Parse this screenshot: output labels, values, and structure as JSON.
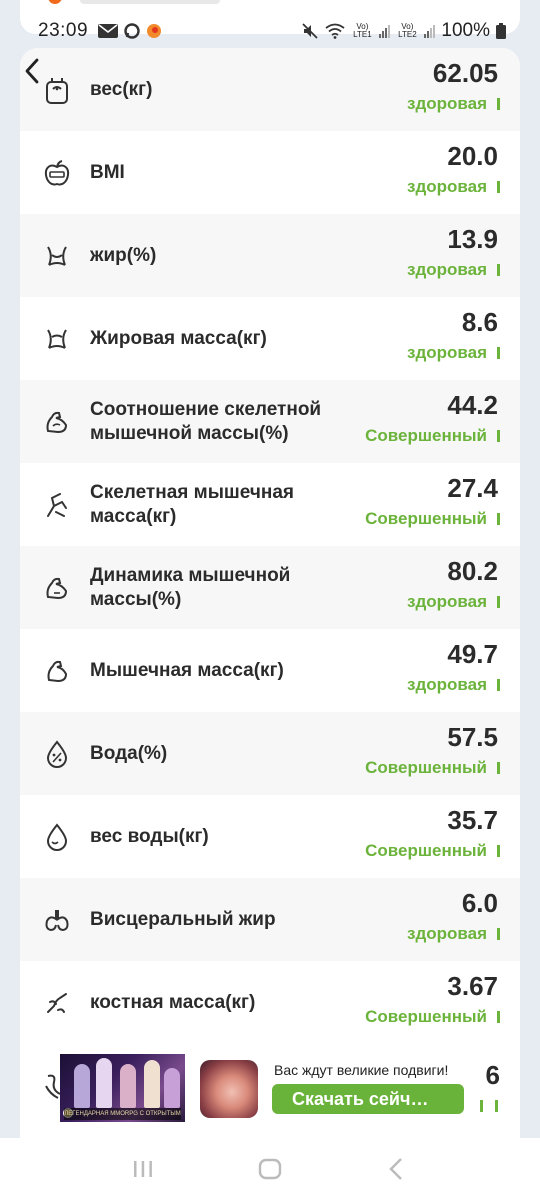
{
  "status_bar": {
    "time": "23:09",
    "battery_text": "100%",
    "sim1_label": "Vo) LTE1",
    "sim2_label": "Vo) LTE2",
    "icons": [
      "mail-icon",
      "messenger-icon",
      "app-notification-icon",
      "mute-icon",
      "wifi-icon",
      "signal-icon",
      "battery-icon"
    ]
  },
  "colors": {
    "accent_green": "#6bb33b",
    "text_dark": "#2b2b2b",
    "row_alt_bg": "#f7f7f7"
  },
  "metrics": [
    {
      "label": "вес(кг)",
      "value": "62.05",
      "status": "здоровая",
      "icon": "scale-icon"
    },
    {
      "label": "BMI",
      "value": "20.0",
      "status": "здоровая",
      "icon": "bmi-apple-icon"
    },
    {
      "label": "жир(%)",
      "value": "13.9",
      "status": "здоровая",
      "icon": "body-fat-icon"
    },
    {
      "label": "Жировая масса(кг)",
      "value": "8.6",
      "status": "здоровая",
      "icon": "fat-mass-icon"
    },
    {
      "label": "Соотношение скелетной мышечной массы(%)",
      "value": "44.2",
      "status": "Совершенный",
      "icon": "muscle-ratio-icon"
    },
    {
      "label": "Скелетная мышечная масса(кг)",
      "value": "27.4",
      "status": "Совершенный",
      "icon": "skeletal-muscle-icon"
    },
    {
      "label": "Динамика мышечной массы(%)",
      "value": "80.2",
      "status": "здоровая",
      "icon": "muscle-dynamics-icon"
    },
    {
      "label": "Мышечная масса(кг)",
      "value": "49.7",
      "status": "здоровая",
      "icon": "muscle-mass-icon"
    },
    {
      "label": "Вода(%)",
      "value": "57.5",
      "status": "Совершенный",
      "icon": "water-percent-icon"
    },
    {
      "label": "вес воды(кг)",
      "value": "35.7",
      "status": "Совершенный",
      "icon": "water-weight-icon"
    },
    {
      "label": "Висцеральный жир",
      "value": "6.0",
      "status": "здоровая",
      "icon": "visceral-fat-icon"
    },
    {
      "label": "костная масса(кг)",
      "value": "3.67",
      "status": "Совершенный",
      "icon": "bone-mass-icon"
    }
  ],
  "ad": {
    "title": "Вас ждут великие подвиги!",
    "cta_label": "Скачать сейч…",
    "banner_caption": "ЛЕГЕНДАРНАЯ MMORPG С ОТКРЫТЫМ МИРОМ",
    "partial_value": "6"
  }
}
